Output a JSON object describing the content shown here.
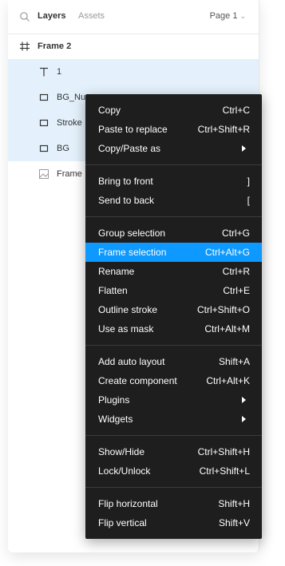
{
  "panel": {
    "tabs": {
      "layers": "Layers",
      "assets": "Assets",
      "page": "Page 1"
    },
    "frame_title": "Frame 2",
    "layers": [
      {
        "icon": "text-icon",
        "label": "1",
        "selected": true
      },
      {
        "icon": "rectangle-icon",
        "label": "BG_Nu",
        "selected": true
      },
      {
        "icon": "rectangle-icon",
        "label": "Stroke",
        "selected": true
      },
      {
        "icon": "rectangle-icon",
        "label": "BG",
        "selected": true
      },
      {
        "icon": "image-icon",
        "label": "Frame",
        "selected": false
      }
    ]
  },
  "context_menu": {
    "groups": [
      [
        {
          "label": "Copy",
          "shortcut": "Ctrl+C"
        },
        {
          "label": "Paste to replace",
          "shortcut": "Ctrl+Shift+R"
        },
        {
          "label": "Copy/Paste as",
          "submenu": true
        }
      ],
      [
        {
          "label": "Bring to front",
          "shortcut": "]"
        },
        {
          "label": "Send to back",
          "shortcut": "["
        }
      ],
      [
        {
          "label": "Group selection",
          "shortcut": "Ctrl+G"
        },
        {
          "label": "Frame selection",
          "shortcut": "Ctrl+Alt+G",
          "highlighted": true
        },
        {
          "label": "Rename",
          "shortcut": "Ctrl+R"
        },
        {
          "label": "Flatten",
          "shortcut": "Ctrl+E"
        },
        {
          "label": "Outline stroke",
          "shortcut": "Ctrl+Shift+O"
        },
        {
          "label": "Use as mask",
          "shortcut": "Ctrl+Alt+M"
        }
      ],
      [
        {
          "label": "Add auto layout",
          "shortcut": "Shift+A"
        },
        {
          "label": "Create component",
          "shortcut": "Ctrl+Alt+K"
        },
        {
          "label": "Plugins",
          "submenu": true
        },
        {
          "label": "Widgets",
          "submenu": true
        }
      ],
      [
        {
          "label": "Show/Hide",
          "shortcut": "Ctrl+Shift+H"
        },
        {
          "label": "Lock/Unlock",
          "shortcut": "Ctrl+Shift+L"
        }
      ],
      [
        {
          "label": "Flip horizontal",
          "shortcut": "Shift+H"
        },
        {
          "label": "Flip vertical",
          "shortcut": "Shift+V"
        }
      ]
    ]
  },
  "colors": {
    "highlight": "#0d99ff",
    "menu_bg": "#1e1e1e",
    "selected_row": "#e4f1fc"
  }
}
